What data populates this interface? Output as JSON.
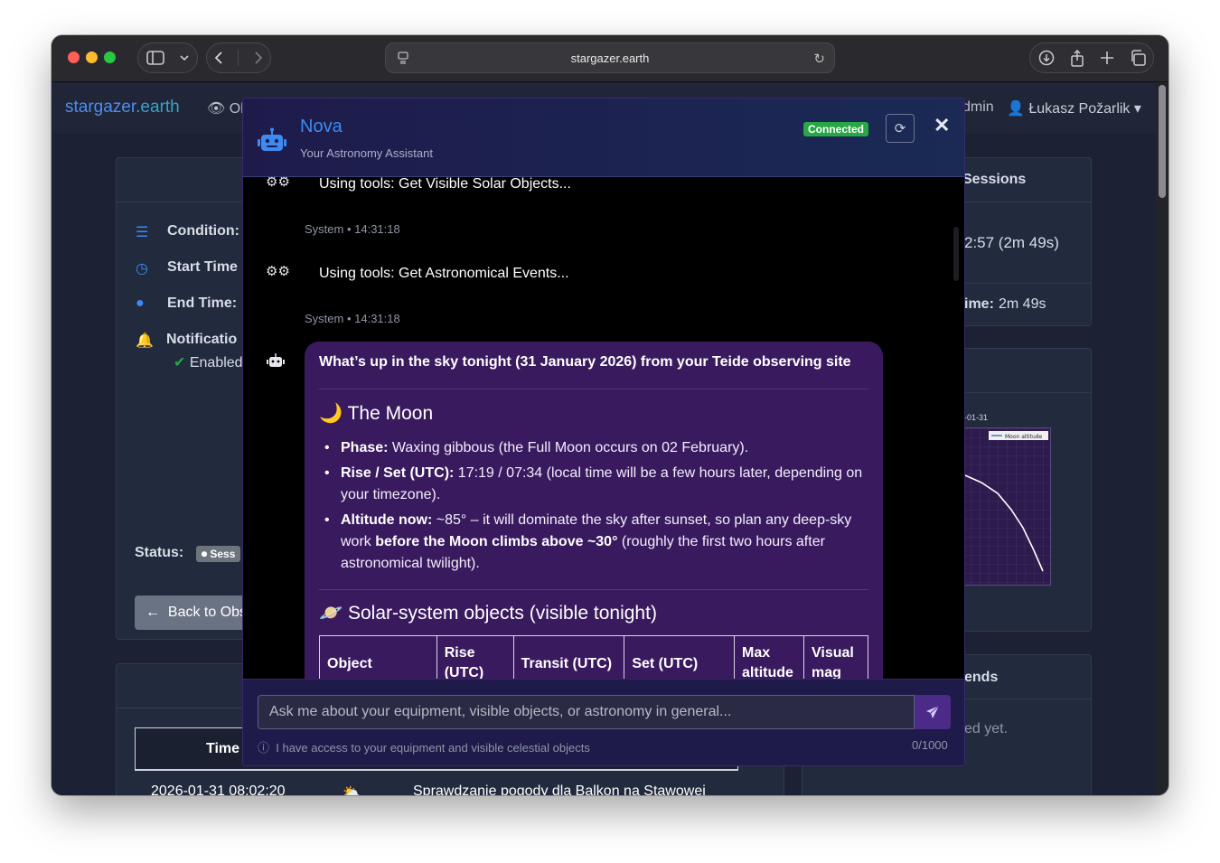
{
  "browser": {
    "url": "stargazer.earth"
  },
  "site": {
    "brand_main": "stargazer",
    "brand_tld": ".earth",
    "nav_observations": "Ob",
    "nav_admin": "dmin",
    "nav_user": "Łukasz Požarlik",
    "caret": "▾"
  },
  "left_card": {
    "condition_label": "Condition:",
    "start_label": "Start Time",
    "end_label": "End Time:",
    "notif_label": "Notificatio",
    "notif_value": "Enabled",
    "status_label": "Status:",
    "status_badge": "Sess",
    "back_button": "Back to Obs",
    "table_time_header": "Time",
    "row_time": "2026-01-31 08:02:20",
    "row_text": "Sprawdzanie pogody dla Balkon na Stawowej"
  },
  "right_cards": {
    "sessions_title": "Sessions",
    "session_time": "2:57 (2m 49s)",
    "time_label": "ime:",
    "time_value": "2m 49s",
    "chart_date": "-01-31",
    "chart_legend": "Moon altitude",
    "trends_title": "ends",
    "trends_empty": "ed yet."
  },
  "chat": {
    "bot_name": "Nova",
    "bot_subtitle": "Your Astronomy Assistant",
    "status": "Connected",
    "messages": {
      "tool_solar": "Using tools: Get Visible Solar Objects...",
      "meta_1": "System • 14:31:18",
      "tool_events": "Using tools: Get Astronomical Events...",
      "meta_2": "System • 14:31:18"
    },
    "reply": {
      "title": "What’s up in the sky tonight (31 January 2026) from your Teide observing site",
      "moon_heading": "🌙 The Moon",
      "phase_label": "Phase:",
      "phase_text": " Waxing gibbous (the Full Moon occurs on 02 February).",
      "rise_label": "Rise / Set (UTC):",
      "rise_text": " 17:19 / 07:34 (local time will be a few hours later, depending on your timezone).",
      "alt_label": "Altitude now:",
      "alt_text_1": " ~85° – it will dominate the sky after sunset, so plan any deep-sky work ",
      "alt_bold": "before the Moon climbs above ~30°",
      "alt_text_2": " (roughly the first two hours after astronomical twilight).",
      "solar_heading": "🪐 Solar-system objects (visible tonight)",
      "table_headers": [
        "Object",
        "Rise (UTC)",
        "Transit (UTC)",
        "Set (UTC)",
        "Max altitude",
        "Visual mag"
      ]
    },
    "input_placeholder": "Ask me about your equipment, visible objects, or astronomy in general...",
    "hint": "I have access to your equipment and visible celestial objects",
    "counter": "0/1000"
  },
  "colors": {
    "accent": "#3d8bf2",
    "bubble": "#3a1a5e",
    "connected": "#28a745",
    "header_bg": "#1e1b4b"
  }
}
